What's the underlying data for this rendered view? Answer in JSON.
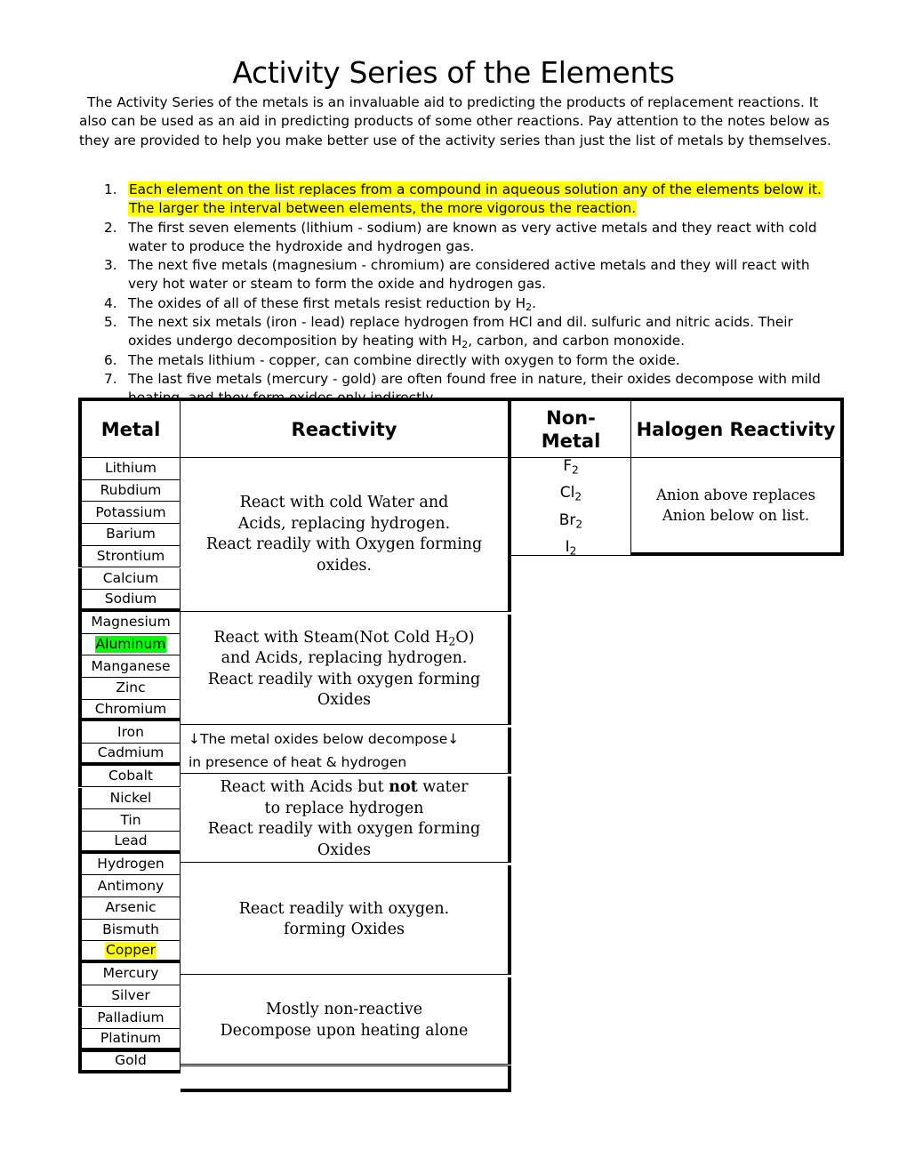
{
  "title": "Activity Series of the Elements",
  "intro": "The Activity Series of the metals is an invaluable aid to predicting the products of replacement reactions. It also can be used as an aid in predicting products of some other reactions. Pay attention to the notes below as they are provided to help you make better use of the activity series than just the list of metals by themselves.",
  "notes": [
    {
      "num": "1.",
      "highlight": "yellow",
      "line1": "Each element on the list replaces from a compound in aqueous solution any of the elements below it.",
      "line2": "The larger the interval between elements, the more vigorous the reaction."
    },
    {
      "num": "2.",
      "highlight": "none",
      "text_a": "The first seven elements (lithium - sodium) are known as very active metals and they react with cold water to produce the hydroxide and hydrogen gas."
    },
    {
      "num": "3.",
      "highlight": "none",
      "text_a": "The next five metals (magnesium - chromium) are considered active metals and they will react with very hot water or steam to form the oxide and hydrogen gas."
    },
    {
      "num": "4.",
      "highlight": "none",
      "text_a": "The oxides of all of these first metals resist reduction by H",
      "sub": "2",
      "text_b": "."
    },
    {
      "num": "5.",
      "highlight": "none",
      "text_a": "The next six metals (iron - lead) replace hydrogen from HCl and dil. sulfuric and nitric acids. Their oxides undergo decomposition by heating with H",
      "sub": "2",
      "text_b": ", carbon, and carbon monoxide."
    },
    {
      "num": "6.",
      "highlight": "none",
      "text_a": "The metals lithium - copper,  can combine directly with oxygen to form the oxide."
    },
    {
      "num": "7.",
      "highlight": "none",
      "text_a": "The last five metals (mercury - gold) are often found free in nature, their oxides decompose with mild heating, and they form oxides only indirectly"
    }
  ],
  "table": {
    "headers": {
      "metal": "Metal",
      "reactivity": "Reactivity",
      "nonmetal_line1": "Non-",
      "nonmetal_line2": "Metal",
      "halogen": "Halogen Reactivity"
    },
    "metals": [
      {
        "name": "Lithium",
        "highlight": "none"
      },
      {
        "name": "Rubdium",
        "highlight": "none"
      },
      {
        "name": "Potassium",
        "highlight": "none"
      },
      {
        "name": "Barium",
        "highlight": "none"
      },
      {
        "name": "Strontium",
        "highlight": "none"
      },
      {
        "name": "Calcium",
        "highlight": "none"
      },
      {
        "name": "Sodium",
        "highlight": "none"
      },
      {
        "name": "Magnesium",
        "highlight": "none"
      },
      {
        "name": "Aluminum",
        "highlight": "green"
      },
      {
        "name": "Manganese",
        "highlight": "none"
      },
      {
        "name": "Zinc",
        "highlight": "none"
      },
      {
        "name": "Chromium",
        "highlight": "none"
      },
      {
        "name": "Iron",
        "highlight": "none"
      },
      {
        "name": "Cadmium",
        "highlight": "none"
      },
      {
        "name": "Cobalt",
        "highlight": "none"
      },
      {
        "name": "Nickel",
        "highlight": "none"
      },
      {
        "name": "Tin",
        "highlight": "none"
      },
      {
        "name": "Lead",
        "highlight": "none"
      },
      {
        "name": "Hydrogen",
        "highlight": "none"
      },
      {
        "name": "Antimony",
        "highlight": "none"
      },
      {
        "name": "Arsenic",
        "highlight": "none"
      },
      {
        "name": "Bismuth",
        "highlight": "none"
      },
      {
        "name": "Copper",
        "highlight": "yellow"
      },
      {
        "name": "Mercury",
        "highlight": "none"
      },
      {
        "name": "Silver",
        "highlight": "none"
      },
      {
        "name": "Palladium",
        "highlight": "none"
      },
      {
        "name": "Platinum",
        "highlight": "none"
      },
      {
        "name": "Gold",
        "highlight": "none"
      }
    ],
    "reactivity_groups": [
      {
        "id": "group-cold-water",
        "line1": "React with cold Water and",
        "line2": "Acids, replacing hydrogen.",
        "line3": "React readily with Oxygen forming oxides."
      },
      {
        "id": "group-steam",
        "line1_a": "React with Steam(Not Cold H",
        "line1_sub": "2",
        "line1_b": "O)",
        "line2": "and Acids, replacing hydrogen.",
        "line3": "React readily with oxygen forming Oxides"
      },
      {
        "id": "group-decompose-note",
        "line1": "↓The metal oxides below decompose↓",
        "line2": "in presence of heat & hydrogen"
      },
      {
        "id": "group-acids-not-water",
        "line1_a": "React with Acids but ",
        "line1_bold": "not",
        "line1_b": " water",
        "line2": "to replace hydrogen",
        "line3": "React readily with oxygen forming Oxides"
      },
      {
        "id": "group-oxygen",
        "line1": "React readily with oxygen.",
        "line2": "forming Oxides"
      },
      {
        "id": "group-non-reactive",
        "line1": "Mostly non-reactive",
        "line2": "Decompose upon heating alone"
      },
      {
        "id": "group-gold-empty",
        "line1": ""
      }
    ],
    "nonmetals": [
      "F",
      "Cl",
      "Br",
      "I"
    ],
    "nonmetal_subscript": "2",
    "halogen_reactivity": {
      "line1": "Anion above replaces",
      "line2": "Anion below on list."
    }
  },
  "colors": {
    "highlight_yellow": "#FFFF00",
    "highlight_green": "#00FF00",
    "border": "#000000",
    "background": "#FFFFFF",
    "text": "#000000"
  }
}
